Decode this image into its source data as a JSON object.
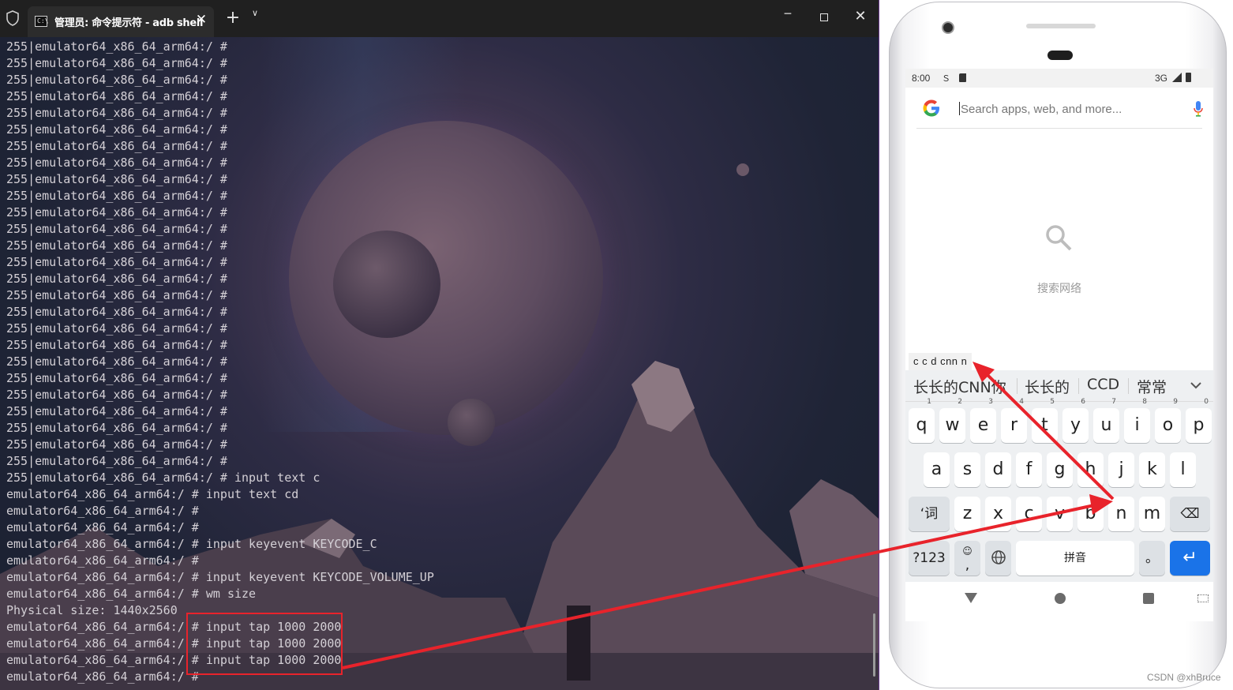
{
  "terminal": {
    "tab_title": "管理员: 命令提示符 - adb  shell",
    "new_tab": "+",
    "tab_dropdown": "∨",
    "close_tab": "✕",
    "minimize": "─",
    "close_window": "✕",
    "lines": [
      "255|emulator64_x86_64_arm64:/ #",
      "255|emulator64_x86_64_arm64:/ #",
      "255|emulator64_x86_64_arm64:/ #",
      "255|emulator64_x86_64_arm64:/ #",
      "255|emulator64_x86_64_arm64:/ #",
      "255|emulator64_x86_64_arm64:/ #",
      "255|emulator64_x86_64_arm64:/ #",
      "255|emulator64_x86_64_arm64:/ #",
      "255|emulator64_x86_64_arm64:/ #",
      "255|emulator64_x86_64_arm64:/ #",
      "255|emulator64_x86_64_arm64:/ #",
      "255|emulator64_x86_64_arm64:/ #",
      "255|emulator64_x86_64_arm64:/ #",
      "255|emulator64_x86_64_arm64:/ #",
      "255|emulator64_x86_64_arm64:/ #",
      "255|emulator64_x86_64_arm64:/ #",
      "255|emulator64_x86_64_arm64:/ #",
      "255|emulator64_x86_64_arm64:/ #",
      "255|emulator64_x86_64_arm64:/ #",
      "255|emulator64_x86_64_arm64:/ #",
      "255|emulator64_x86_64_arm64:/ #",
      "255|emulator64_x86_64_arm64:/ #",
      "255|emulator64_x86_64_arm64:/ #",
      "255|emulator64_x86_64_arm64:/ #",
      "255|emulator64_x86_64_arm64:/ #",
      "255|emulator64_x86_64_arm64:/ #",
      "255|emulator64_x86_64_arm64:/ # input text c",
      "emulator64_x86_64_arm64:/ # input text cd",
      "emulator64_x86_64_arm64:/ #",
      "emulator64_x86_64_arm64:/ #",
      "emulator64_x86_64_arm64:/ # input keyevent KEYCODE_C",
      "emulator64_x86_64_arm64:/ #",
      "emulator64_x86_64_arm64:/ # input keyevent KEYCODE_VOLUME_UP",
      "emulator64_x86_64_arm64:/ # wm size",
      "Physical size: 1440x2560",
      "emulator64_x86_64_arm64:/ # input tap 1000 2000",
      "emulator64_x86_64_arm64:/ # input tap 1000 2000",
      "emulator64_x86_64_arm64:/ # input tap 1000 2000",
      "emulator64_x86_64_arm64:/ #"
    ]
  },
  "phone": {
    "status": {
      "time": "8:00",
      "network": "3G"
    },
    "search": {
      "placeholder": "Search apps, web, and more..."
    },
    "empty_label": "搜索网络",
    "composing": "c c d cnn n",
    "candidates": [
      "长长的CNN你",
      "长长的",
      "CCD",
      "常常"
    ],
    "keyboard": {
      "row1": [
        {
          "key": "q",
          "hint": "1"
        },
        {
          "key": "w",
          "hint": "2"
        },
        {
          "key": "e",
          "hint": "3"
        },
        {
          "key": "r",
          "hint": "4"
        },
        {
          "key": "t",
          "hint": "5"
        },
        {
          "key": "y",
          "hint": "6"
        },
        {
          "key": "u",
          "hint": "7"
        },
        {
          "key": "i",
          "hint": "8"
        },
        {
          "key": "o",
          "hint": "9"
        },
        {
          "key": "p",
          "hint": "0"
        }
      ],
      "row2": [
        "a",
        "s",
        "d",
        "f",
        "g",
        "h",
        "j",
        "k",
        "l"
      ],
      "row3": [
        "z",
        "x",
        "c",
        "v",
        "b",
        "n",
        "m"
      ],
      "shift_label": "‘词",
      "numbers_label": "?123",
      "emoji_comma": ",",
      "space_label": "拼音",
      "period_label": "。",
      "enter_label": "↵",
      "backspace_label": "⌫"
    }
  },
  "watermark": "CSDN @xhBruce",
  "colors": {
    "annotation": "#e8232b",
    "enter_key": "#1a73e8",
    "terminal_title": "#202020"
  }
}
